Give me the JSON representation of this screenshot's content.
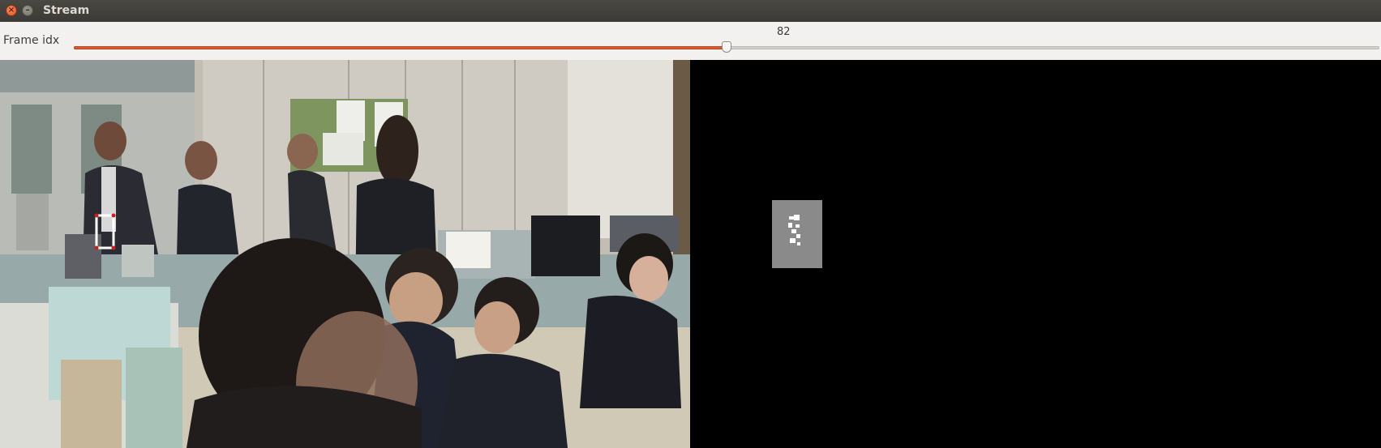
{
  "window": {
    "title": "Stream",
    "close_icon": "close-icon",
    "minimize_icon": "minimize-icon"
  },
  "toolbar": {
    "slider_label": "Frame idx",
    "slider_value": "82",
    "slider_fraction": 0.5
  },
  "panes": {
    "video": "office-video-frame",
    "mask": "segmentation-mask"
  },
  "colors": {
    "accent": "#e05a2d",
    "titlebar": "#3b3a36",
    "mask_background": "#000000",
    "mask_region": "#8a8a8a",
    "track_box": "#ffffff"
  }
}
